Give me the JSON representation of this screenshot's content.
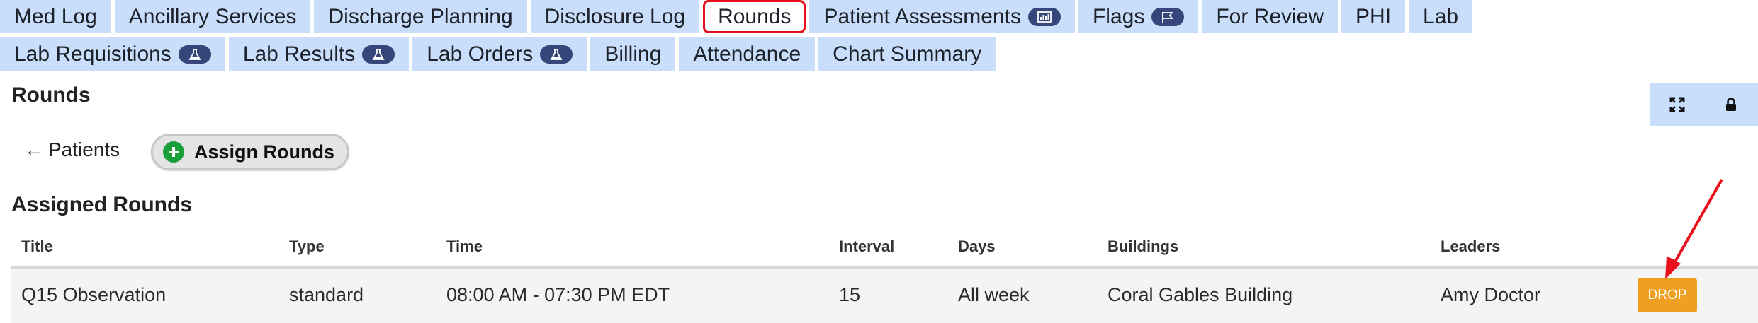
{
  "tabs_row1": [
    {
      "label": "Med Log",
      "badge": null,
      "active": false
    },
    {
      "label": "Ancillary Services",
      "badge": null,
      "active": false
    },
    {
      "label": "Discharge Planning",
      "badge": null,
      "active": false
    },
    {
      "label": "Disclosure Log",
      "badge": null,
      "active": false
    },
    {
      "label": "Rounds",
      "badge": null,
      "active": true
    },
    {
      "label": "Patient Assessments",
      "badge": "chart-icon",
      "active": false
    },
    {
      "label": "Flags",
      "badge": "flag-icon",
      "active": false
    },
    {
      "label": "For Review",
      "badge": null,
      "active": false
    },
    {
      "label": "PHI",
      "badge": null,
      "active": false
    },
    {
      "label": "Lab",
      "badge": null,
      "active": false
    }
  ],
  "tabs_row2": [
    {
      "label": "Lab Requisitions",
      "badge": "flask-icon",
      "active": false
    },
    {
      "label": "Lab Results",
      "badge": "flask-icon",
      "active": false
    },
    {
      "label": "Lab Orders",
      "badge": "flask-icon",
      "active": false
    },
    {
      "label": "Billing",
      "badge": null,
      "active": false
    },
    {
      "label": "Attendance",
      "badge": null,
      "active": false
    },
    {
      "label": "Chart Summary",
      "badge": null,
      "active": false
    }
  ],
  "page": {
    "title": "Rounds",
    "back_arrow": "←",
    "back_label": "Patients",
    "assign_label": "Assign Rounds",
    "section_title": "Assigned Rounds",
    "controls": [
      "expand-icon",
      "lock-icon"
    ]
  },
  "table": {
    "headers": {
      "title": "Title",
      "type": "Type",
      "time": "Time",
      "interval": "Interval",
      "days": "Days",
      "buildings": "Buildings",
      "leaders": "Leaders"
    },
    "rows": [
      {
        "title": "Q15 Observation",
        "type": "standard",
        "time": "08:00 AM - 07:30 PM EDT",
        "interval": "15",
        "days": "All week",
        "buildings": "Coral Gables Building",
        "leaders": "Amy Doctor",
        "action": "DROP"
      }
    ]
  },
  "colors": {
    "tab_bg": "#c9defa",
    "active_outline": "#e8101d",
    "badge_bg": "#34467a",
    "drop_button": "#f0a020",
    "assign_icon": "#19a03b",
    "annotation_arrow": "#e8101d"
  }
}
